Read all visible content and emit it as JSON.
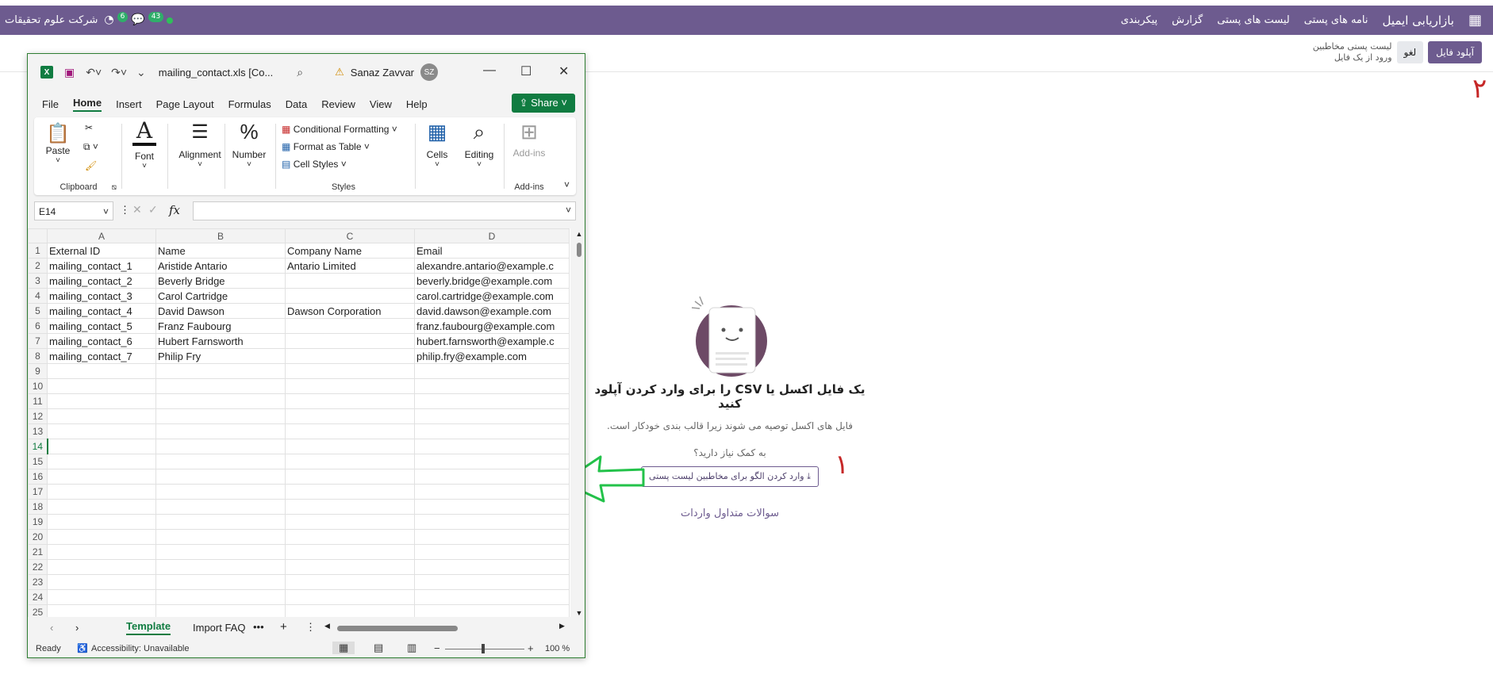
{
  "topbar": {
    "app_name": "بازاریابی ایمیل",
    "menu": [
      "نامه های پستی",
      "لیست های پستی",
      "گزارش",
      "پیکربندی"
    ],
    "company": "شرکت علوم تحقیقات",
    "activity_badge": "6",
    "message_badge": "43"
  },
  "control_panel": {
    "upload_label": "آپلود فایل",
    "cancel_label": "لغو",
    "breadcrumb_top": "لیست پستی مخاطبین",
    "breadcrumb_bottom": "ورود از یک فایل"
  },
  "annotations": {
    "marker_1": "١",
    "marker_2": "٢"
  },
  "help": {
    "title": "یک فایل اکسل یا CSV را برای وارد کردن آپلود کنید",
    "subtitle": "فایل های اکسل توصیه می شوند زیرا قالب بندی خودکار است.",
    "need_help": "به کمک نیاز دارید؟",
    "template_button": "وارد کردن الگو برای مخاطبین لیست پستی",
    "faq_link": "سوالات متداول واردات"
  },
  "excel": {
    "file_name": "mailing_contact.xls  [Co...",
    "user_name": "Sanaz Zavvar",
    "user_initials": "SZ",
    "menu": [
      "File",
      "Home",
      "Insert",
      "Page Layout",
      "Formulas",
      "Data",
      "Review",
      "View",
      "Help"
    ],
    "share_label": "Share",
    "ribbon": {
      "paste": "Paste",
      "clipboard": "Clipboard",
      "font": "Font",
      "alignment": "Alignment",
      "number": "Number",
      "conditional_formatting": "Conditional Formatting",
      "format_as_table": "Format as Table",
      "cell_styles": "Cell Styles",
      "styles": "Styles",
      "cells": "Cells",
      "editing": "Editing",
      "addins_button": "Add-ins",
      "addins_group": "Add-ins"
    },
    "name_box": "E14",
    "formula_content": "",
    "columns": [
      "A",
      "B",
      "C",
      "D"
    ],
    "rows": [
      [
        "External ID",
        "Name",
        "Company Name",
        "Email"
      ],
      [
        "mailing_contact_1",
        "Aristide Antario",
        "Antario Limited",
        "alexandre.antario@example.c"
      ],
      [
        "mailing_contact_2",
        "Beverly Bridge",
        "",
        "beverly.bridge@example.com"
      ],
      [
        "mailing_contact_3",
        "Carol Cartridge",
        "",
        "carol.cartridge@example.com"
      ],
      [
        "mailing_contact_4",
        "David Dawson",
        "Dawson Corporation",
        "david.dawson@example.com"
      ],
      [
        "mailing_contact_5",
        "Franz Faubourg",
        "",
        "franz.faubourg@example.com"
      ],
      [
        "mailing_contact_6",
        "Hubert Farnsworth",
        "",
        "hubert.farnsworth@example.c"
      ],
      [
        "mailing_contact_7",
        "Philip Fry",
        "",
        "philip.fry@example.com"
      ]
    ],
    "total_rows": 25,
    "selected_row": 14,
    "sheet_tabs": [
      "Template",
      "Import FAQ"
    ],
    "active_tab": "Template",
    "status_ready": "Ready",
    "status_accessibility": "Accessibility: Unavailable",
    "zoom": "100 %"
  }
}
